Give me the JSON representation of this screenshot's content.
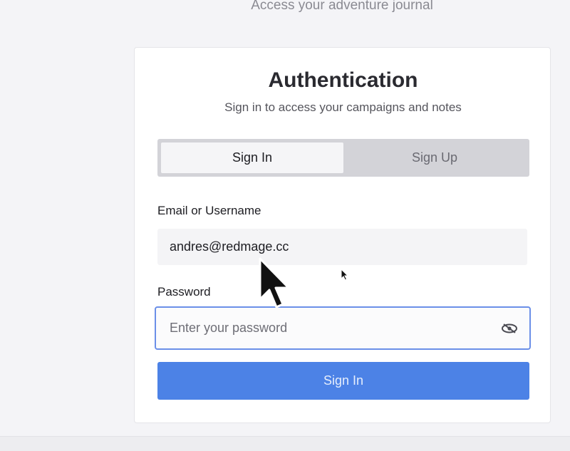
{
  "header": {
    "tagline": "Access your adventure journal"
  },
  "auth_card": {
    "title": "Authentication",
    "subtitle": "Sign in to access your campaigns and notes",
    "tabs": [
      {
        "label": "Sign In",
        "active": true
      },
      {
        "label": "Sign Up",
        "active": false
      }
    ],
    "email": {
      "label": "Email or Username",
      "value": "andres@redmage.cc"
    },
    "password": {
      "label": "Password",
      "placeholder": "Enter your password",
      "value": "",
      "toggle_icon": "eye-icon"
    },
    "submit_label": "Sign In"
  },
  "colors": {
    "accent": "#4c82e6",
    "focus_border": "#6b8fe8",
    "background": "#f4f4f7"
  }
}
